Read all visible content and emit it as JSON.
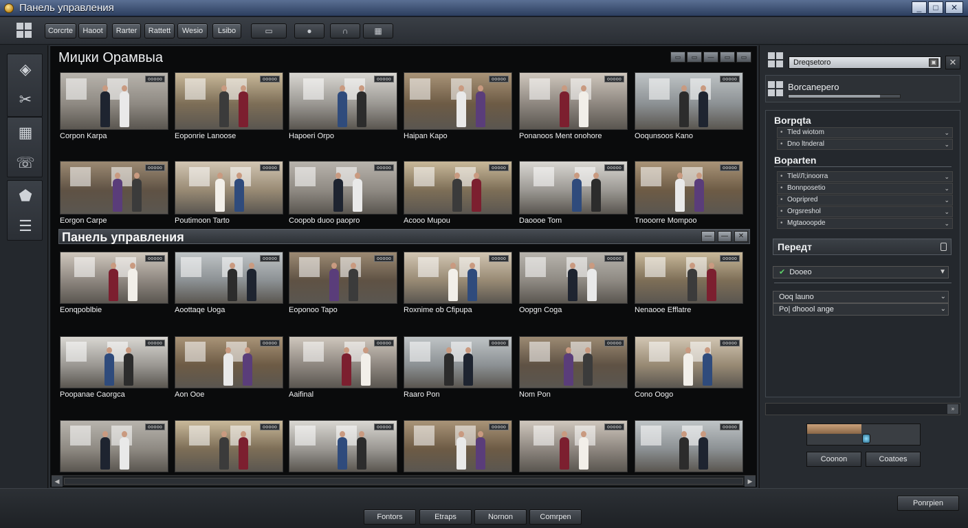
{
  "window": {
    "title": "Панель управления",
    "controls": [
      "_",
      "□",
      "✕"
    ]
  },
  "toolbar": {
    "buttons": [
      "Corcrte",
      "Haoot",
      "Rarter",
      "Rattett",
      "Wesio",
      "Lsibo"
    ],
    "icon_buttons": [
      "monitor-icon",
      "circle-icon",
      "headset-icon",
      "film-icon"
    ]
  },
  "sidebar": {
    "icons": [
      "tag-icon",
      "tools-icon",
      "layout-icon",
      "phone-icon",
      "shield-icon",
      "list-icon"
    ]
  },
  "gallery": {
    "title": "Миџки Орамвыа",
    "tools": [
      "▭",
      "▭",
      "—",
      "▭",
      "▭"
    ],
    "section_title": "Панель управления",
    "section_tools": [
      "—",
      "—",
      "✕"
    ],
    "rows": [
      [
        "Corpon Karpa",
        "Eoponrie Lanoose",
        "Hapoeri Orpo",
        "Haipan Kapo",
        "Ponanoos Ment onohore",
        "Ooqunsoos Kano"
      ],
      [
        "Eorgon Carpe",
        "Poutimoon Tarto",
        "Coopob duoo paopro",
        "Acooo Mupou",
        "Daoooe Tom",
        "Tnooorre Mompoo"
      ],
      [
        "Eonqpoblbie",
        "Aoottaqe Uoga",
        "Eoponoo Tapo",
        "Roxnime ob Cfipupa",
        "Oopgn Coga",
        "Nenaooe Efflatre"
      ],
      [
        "Poopanae Caorgca",
        "Aon Ooe",
        "Aaifinal",
        "Raaro Pon",
        "Nom Pon",
        "Cono Oogo"
      ],
      [
        "",
        "",
        "",
        "",
        "",
        ""
      ]
    ],
    "badge": "ooooo"
  },
  "right_panel": {
    "search_value": "Dreqsetoro",
    "box_label": "Borcanepero",
    "box_progress": 0.82,
    "section1": {
      "title": "Borpqta",
      "options": [
        "Tled wiotom",
        "Dno ltnderal"
      ]
    },
    "section2": {
      "title": "Boparten",
      "options": [
        "Tlel/Л;inoorra",
        "Bonnposetio",
        "Oopripred",
        "Orgsreshol",
        "Mgtaooopde"
      ]
    },
    "peredi": "Передт",
    "dropdown_checked": "Dooeo",
    "dropdowns": [
      "Ooq launo",
      "Po| dhoool ange"
    ],
    "scroll_label": "»",
    "color_fill": 0.48,
    "btn_left": "Coonon",
    "btn_right": "Coatoes"
  },
  "statusbar": {
    "buttons": [
      "Fontors",
      "Etraps",
      "Nornon",
      "Comrpen"
    ],
    "right_button": "Ponrpien"
  },
  "colors": {
    "title_bar": "#3a4f75",
    "background": "#23272c",
    "gallery_bg": "#0a0b0c"
  }
}
